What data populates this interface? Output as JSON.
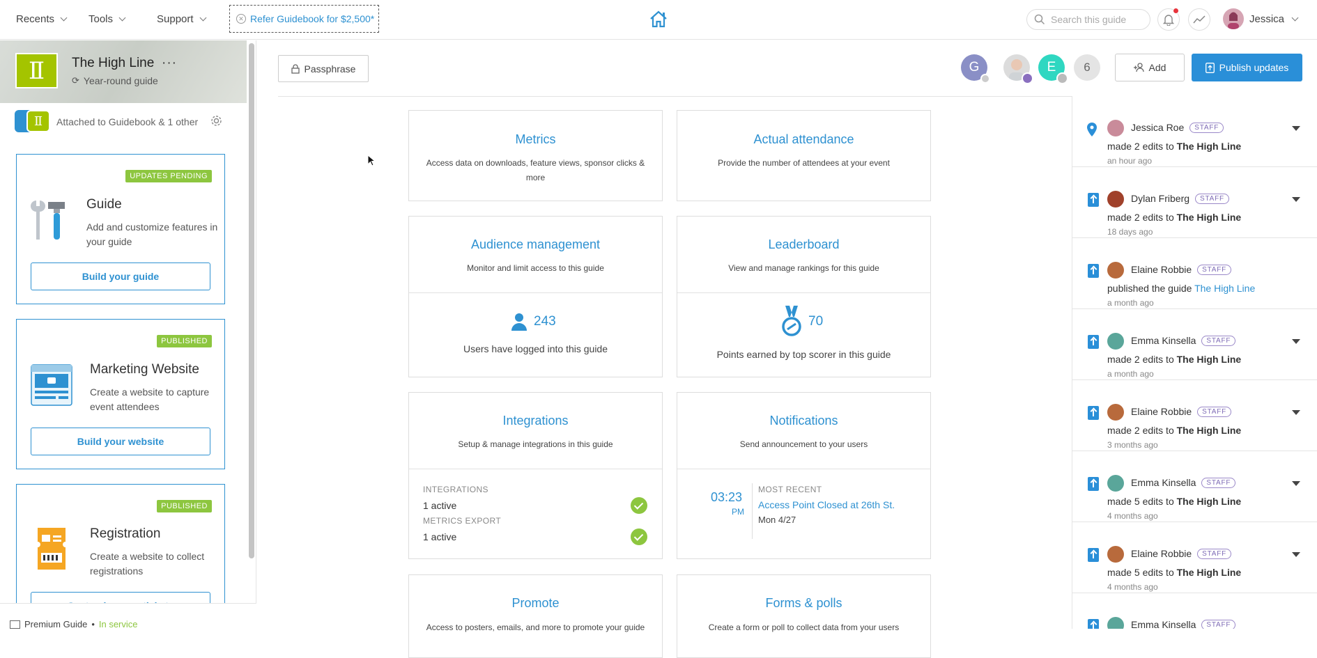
{
  "topnav": {
    "recents": "Recents",
    "tools": "Tools",
    "support": "Support",
    "refer": "Refer Guidebook for $2,500*",
    "search_placeholder": "Search this guide",
    "user_name": "Jessica"
  },
  "guide": {
    "name": "The High Line",
    "subtitle": "Year-round guide",
    "attached": "Attached to Guidebook & 1 other"
  },
  "cards": [
    {
      "badge": "UPDATES PENDING",
      "title": "Guide",
      "desc": "Add and customize features in your guide",
      "button": "Build your guide"
    },
    {
      "badge": "PUBLISHED",
      "title": "Marketing Website",
      "desc": "Create a website to capture event attendees",
      "button": "Build your website"
    },
    {
      "badge": "PUBLISHED",
      "title": "Registration",
      "desc": "Create a website to collect registrations",
      "button": "Customize your tickets"
    }
  ],
  "footer": {
    "plan": "Premium Guide",
    "separator": "•",
    "status": "In service"
  },
  "toolbar": {
    "passphrase": "Passphrase",
    "collab_initials": [
      "G",
      "E"
    ],
    "collab_more": "6",
    "add": "Add",
    "publish": "Publish updates"
  },
  "tiles": {
    "metrics": {
      "title": "Metrics",
      "desc": "Access data on downloads, feature views, sponsor clicks & more"
    },
    "attendance": {
      "title": "Actual attendance",
      "desc": "Provide the number of attendees at your event"
    },
    "audience": {
      "title": "Audience management",
      "desc": "Monitor and limit access to this guide",
      "stat": "243",
      "stat_label": "Users have logged into this guide"
    },
    "leaderboard": {
      "title": "Leaderboard",
      "desc": "View and manage rankings for this guide",
      "stat": "70",
      "stat_label": "Points earned by top scorer in this guide"
    },
    "integrations": {
      "title": "Integrations",
      "desc": "Setup & manage integrations in this guide",
      "label1": "INTEGRATIONS",
      "value1": "1 active",
      "label2": "METRICS EXPORT",
      "value2": "1 active"
    },
    "notifications": {
      "title": "Notifications",
      "desc": "Send announcement to your users",
      "time": "03:23",
      "ampm": "PM",
      "recent_label": "MOST RECENT",
      "recent_title": "Access Point Closed at 26th St.",
      "recent_date": "Mon 4/27"
    },
    "promote": {
      "title": "Promote",
      "desc": "Access to posters, emails, and more to promote your guide"
    },
    "forms": {
      "title": "Forms & polls",
      "desc": "Create a form or poll to collect data from your users"
    }
  },
  "activity": [
    {
      "name": "Jessica Roe",
      "badge": "STAFF",
      "action": "made 2 edits to",
      "target": "The High Line",
      "time": "an hour ago",
      "icon": "location-pin-icon",
      "avatar_color": "#c98b9a"
    },
    {
      "name": "Dylan Friberg",
      "badge": "STAFF",
      "action": "made 2 edits to",
      "target": "The High Line",
      "time": "18 days ago",
      "icon": "publish-icon",
      "avatar_color": "#a0412b"
    },
    {
      "name": "Elaine Robbie",
      "badge": "STAFF",
      "action": "published the guide",
      "target": "The High Line",
      "time": "a month ago",
      "icon": "publish-icon",
      "avatar_color": "#b86a3c"
    },
    {
      "name": "Emma Kinsella",
      "badge": "STAFF",
      "action": "made 2 edits to",
      "target": "The High Line",
      "time": "a month ago",
      "icon": "publish-icon",
      "avatar_color": "#5aa69a"
    },
    {
      "name": "Elaine Robbie",
      "badge": "STAFF",
      "action": "made 2 edits to",
      "target": "The High Line",
      "time": "3 months ago",
      "icon": "publish-icon",
      "avatar_color": "#b86a3c"
    },
    {
      "name": "Emma Kinsella",
      "badge": "STAFF",
      "action": "made 5 edits to",
      "target": "The High Line",
      "time": "4 months ago",
      "icon": "publish-icon",
      "avatar_color": "#5aa69a"
    },
    {
      "name": "Elaine Robbie",
      "badge": "STAFF",
      "action": "made 5 edits to",
      "target": "The High Line",
      "time": "4 months ago",
      "icon": "publish-icon",
      "avatar_color": "#b86a3c"
    },
    {
      "name": "Emma Kinsella",
      "badge": "STAFF",
      "action": "",
      "target": "",
      "time": "",
      "icon": "publish-icon",
      "avatar_color": "#5aa69a"
    }
  ],
  "colors": {
    "accent": "#2e91d1",
    "publish": "#2a8fd8",
    "success": "#8dc63f",
    "staff_badge": "#7d6ab5",
    "guide_logo": "#a4c400"
  }
}
